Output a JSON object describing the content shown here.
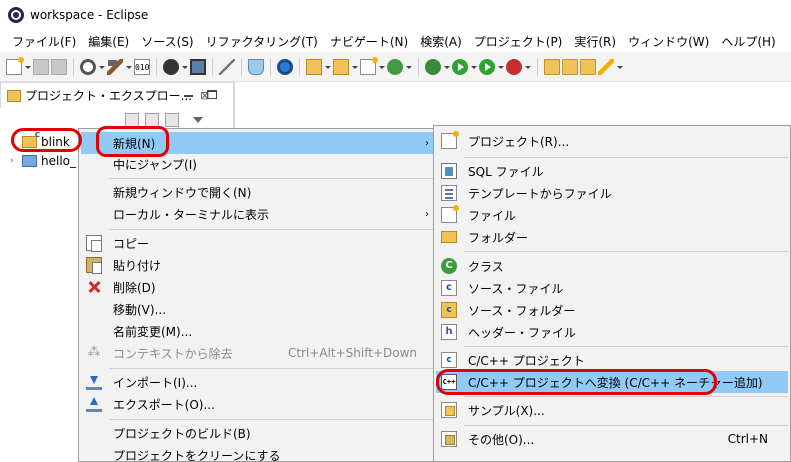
{
  "window": {
    "title": "workspace - Eclipse"
  },
  "menubar": {
    "items": [
      "ファイル(F)",
      "編集(E)",
      "ソース(S)",
      "リファクタリング(T)",
      "ナビゲート(N)",
      "検索(A)",
      "プロジェクト(P)",
      "実行(R)",
      "ウィンドウ(W)",
      "ヘルプ(H)"
    ]
  },
  "toolbar": {
    "binary_label": "010"
  },
  "explorer": {
    "title": "プロジェクト・エクスプロー...",
    "close_glyph": "⊠",
    "items": [
      {
        "label": "blink"
      },
      {
        "label": "hello_"
      }
    ]
  },
  "context_menu": {
    "items": [
      {
        "label": "新規(N)"
      },
      {
        "label": "中にジャンプ(I)"
      },
      {
        "label": "新規ウィンドウで開く(N)"
      },
      {
        "label": "ローカル・ターミナルに表示"
      },
      {
        "label": "コピー"
      },
      {
        "label": "貼り付け"
      },
      {
        "label": "削除(D)"
      },
      {
        "label": "移動(V)..."
      },
      {
        "label": "名前変更(M)..."
      },
      {
        "label": "コンテキストから除去",
        "shortcut": "Ctrl+Alt+Shift+Down"
      },
      {
        "label": "インポート(I)..."
      },
      {
        "label": "エクスポート(O)..."
      },
      {
        "label": "プロジェクトのビルド(B)"
      },
      {
        "label": "プロジェクトをクリーンにする"
      }
    ]
  },
  "submenu": {
    "items": [
      {
        "label": "プロジェクト(R)..."
      },
      {
        "label": "SQL ファイル"
      },
      {
        "label": "テンプレートからファイル"
      },
      {
        "label": "ファイル"
      },
      {
        "label": "フォルダー"
      },
      {
        "label": "クラス"
      },
      {
        "label": "ソース・ファイル"
      },
      {
        "label": "ソース・フォルダー"
      },
      {
        "label": "ヘッダー・ファイル"
      },
      {
        "label": "C/C++ プロジェクト"
      },
      {
        "label": "C/C++ プロジェクトへ変換 (C/C++ ネーチャー追加)"
      },
      {
        "label": "サンプル(X)..."
      },
      {
        "label": "その他(O)...",
        "shortcut": "Ctrl+N"
      }
    ],
    "icon_text": {
      "class": "C",
      "source": "c",
      "srcfolder": "c",
      "header": "h",
      "cproj": "c",
      "convert": "C++"
    }
  },
  "colors": {
    "highlight": "#91c9f7",
    "annotation": "#e00000",
    "menu_bg": "#f2f2f2"
  }
}
